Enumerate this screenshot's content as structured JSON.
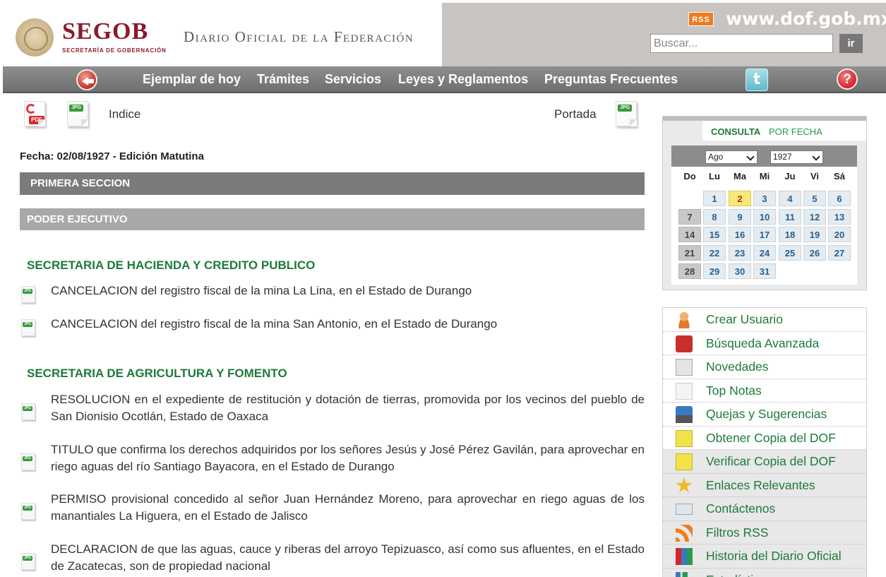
{
  "header": {
    "brand": "SEGOB",
    "brand_subtitle": "SECRETARÍA DE GOBERNACIÓN",
    "title": "Diario Oficial de la Federación",
    "rss_badge": "RSS",
    "site_url": "www.dof.gob.mx",
    "search_placeholder": "Buscar...",
    "search_button": "ir"
  },
  "nav": {
    "items": [
      "Ejemplar de hoy",
      "Trámites",
      "Servicios",
      "Leyes y Reglamentos",
      "Preguntas Frecuentes"
    ],
    "help_glyph": "?"
  },
  "toolbar": {
    "pdf_tag": "PDF",
    "jpg_tag": "JPG",
    "indice": "Indice",
    "portada": "Portada"
  },
  "edition": {
    "fecha": "Fecha: 02/08/1927 - Edición Matutina",
    "section": "PRIMERA SECCION",
    "subsection": "PODER EJECUTIVO"
  },
  "sections": [
    {
      "heading": "SECRETARIA DE HACIENDA Y CREDITO PUBLICO",
      "entries": [
        "CANCELACION del registro fiscal de la mina La Lina, en el Estado de Durango",
        "CANCELACION del registro fiscal de la mina San Antonio, en el Estado de Durango"
      ]
    },
    {
      "heading": "SECRETARIA DE AGRICULTURA Y FOMENTO",
      "entries": [
        "RESOLUCION en el expediente de restitución y dotación de tierras, promovida por los vecinos del pueblo de San Dionisio Ocotlán, Estado de Oaxaca",
        "TITULO que confirma los derechos adquiridos por los señores Jesús y José Pérez Gavilán, para aprovechar en riego aguas del río Santiago Bayacora, en el Estado de Durango",
        "PERMISO provisional concedido al señor Juan Hernández Moreno, para aprovechar en riego aguas de los manantiales La Higuera, en el Estado de Jalisco",
        "DECLARACION de que las aguas, cauce y riberas del arroyo Tepizuasco, así como sus afluentes, en el Estado de Zacatecas, son de propiedad nacional"
      ]
    }
  ],
  "calendar": {
    "consulta": "CONSULTA",
    "por_fecha": "POR FECHA",
    "month": "Ago",
    "year": "1927",
    "weekdays": [
      "Do",
      "Lu",
      "Ma",
      "Mi",
      "Ju",
      "Vi",
      "Sá"
    ],
    "days": [
      "1",
      "2",
      "3",
      "4",
      "5",
      "6",
      "7",
      "8",
      "9",
      "10",
      "11",
      "12",
      "13",
      "14",
      "15",
      "16",
      "17",
      "18",
      "19",
      "20",
      "21",
      "22",
      "23",
      "24",
      "25",
      "26",
      "27",
      "28",
      "29",
      "30",
      "31"
    ],
    "selected_day": "2"
  },
  "menu": [
    {
      "label": "Crear Usuario",
      "icon": "user-add-icon"
    },
    {
      "label": "Búsqueda Avanzada",
      "icon": "magnifier-icon"
    },
    {
      "label": "Novedades",
      "icon": "newspaper-icon"
    },
    {
      "label": "Top Notas",
      "icon": "star-document-icon"
    },
    {
      "label": "Quejas y Sugerencias",
      "icon": "mailbox-icon"
    },
    {
      "label": "Obtener Copia del DOF",
      "icon": "document-copy-icon"
    },
    {
      "label": "Verificar Copia del DOF",
      "icon": "document-check-icon"
    },
    {
      "label": "Enlaces Relevantes",
      "icon": "star-icon"
    },
    {
      "label": "Contáctenos",
      "icon": "contact-card-icon"
    },
    {
      "label": "Filtros RSS",
      "icon": "rss-icon"
    },
    {
      "label": "Historia del Diario Oficial",
      "icon": "books-icon"
    },
    {
      "label": "Estadísticas",
      "icon": "chart-icon"
    }
  ],
  "colors": {
    "brand": "#8b1a2b",
    "green": "#1e7a3a",
    "nav": "#7a7a7a"
  }
}
